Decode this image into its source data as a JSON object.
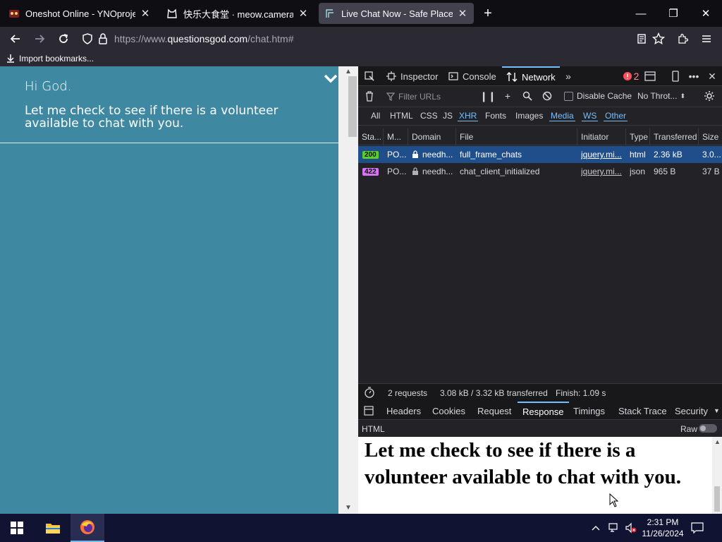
{
  "tabs": [
    {
      "title": "Oneshot Online - YNOproject",
      "favicon": "oneshot-favicon",
      "active": false
    },
    {
      "title": "快乐大食堂 · meow.camera",
      "favicon": "cat-favicon",
      "active": false
    },
    {
      "title": "Live Chat Now - Safe Place to talk",
      "favicon": "chat-favicon",
      "active": true
    }
  ],
  "window": {
    "minimize": "—",
    "restore": "❐",
    "close": "✕"
  },
  "nav": {
    "url_prefix": "https://www.",
    "url_host": "questionsgod.com",
    "url_path": "/chat.htm#"
  },
  "bookmarks": {
    "import_label": "Import bookmarks..."
  },
  "page": {
    "greeting": "Hi God.",
    "message": "Let me check to see if there is a volunteer available to chat with you."
  },
  "devtools": {
    "tabs": {
      "inspector": "Inspector",
      "console": "Console",
      "network": "Network"
    },
    "error_count": "2",
    "filter_placeholder": "Filter URLs",
    "disable_cache": "Disable Cache",
    "throttle": "No Throt...",
    "type_filters": [
      "All",
      "HTML",
      "CSS",
      "JS",
      "XHR",
      "Fonts",
      "Images",
      "Media",
      "WS",
      "Other"
    ],
    "columns": [
      "Sta...",
      "M...",
      "Domain",
      "File",
      "Initiator",
      "Type",
      "Transferred",
      "Size"
    ],
    "requests": [
      {
        "status": "200",
        "method": "PO...",
        "domain": "needh...",
        "file": "full_frame_chats",
        "initiator": "jquery.mi...",
        "type": "html",
        "transferred": "2.36 kB",
        "size": "3.0..."
      },
      {
        "status": "422",
        "method": "PO...",
        "domain": "needh...",
        "file": "chat_client_initialized",
        "initiator": "jquery.mi...",
        "type": "json",
        "transferred": "965 B",
        "size": "37 B"
      }
    ],
    "summary": {
      "requests": "2 requests",
      "transferred": "3.08 kB / 3.32 kB transferred",
      "finish": "Finish: 1.09 s"
    },
    "detail_tabs": [
      "Headers",
      "Cookies",
      "Request",
      "Response",
      "Timings",
      "Stack Trace",
      "Security"
    ],
    "response_format": "HTML",
    "raw_label": "Raw",
    "response_text": "Let me check to see if there is a volunteer available to chat with you."
  },
  "taskbar": {
    "time": "2:31 PM",
    "date": "11/26/2024"
  },
  "colors": {
    "page_bg": "#3e88a1",
    "selected_row": "#204e8a",
    "accent": "#75bfff",
    "status_200": "#58cf2b",
    "status_422": "#d474f0",
    "taskbar": "#101332"
  }
}
